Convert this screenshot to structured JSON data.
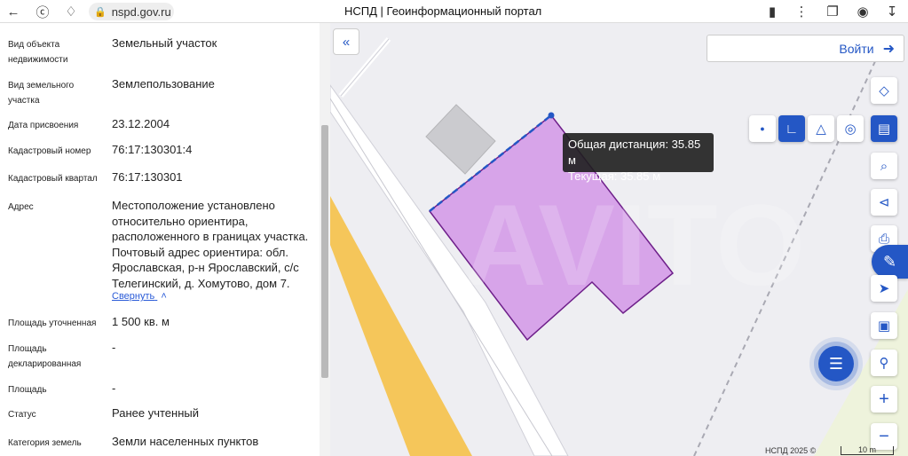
{
  "browser": {
    "url": "nspd.gov.ru",
    "title": "НСПД | Геоинформационный портал"
  },
  "properties": [
    {
      "label": "Вид объекта недвижимости",
      "value": "Земельный участок"
    },
    {
      "label": "Вид земельного участка",
      "value": "Землепользование"
    },
    {
      "label": "Дата присвоения",
      "value": "23.12.2004"
    },
    {
      "label": "Кадастровый номер",
      "value": "76:17:130301:4"
    },
    {
      "label": "Кадастровый квартал",
      "value": "76:17:130301"
    },
    {
      "label": "Адрес",
      "value": "Местоположение установлено относительно ориентира, расположенного в границах участка. Почтовый адрес ориентира: обл. Ярославская, р-н Ярославский, с/с Телегинский, д. Хомутово, дом 7."
    },
    {
      "label": "Площадь уточненная",
      "value": "1 500 кв. м"
    },
    {
      "label": "Площадь декларированная",
      "value": "-"
    },
    {
      "label": "Площадь",
      "value": "-"
    },
    {
      "label": "Статус",
      "value": "Ранее учтенный"
    },
    {
      "label": "Категория земель",
      "value": "Земли населенных пунктов"
    }
  ],
  "collapse_label": "Свернуть",
  "map": {
    "login_label": "Войти",
    "tooltip": {
      "total": "Общая дистанция: 35.85 м",
      "current": "Текущая: 35.85 м"
    },
    "copyright": "НСПД 2025 ©",
    "scale": "10 m",
    "parcel_color": "#d49be8",
    "accent_color": "#2457c5"
  }
}
